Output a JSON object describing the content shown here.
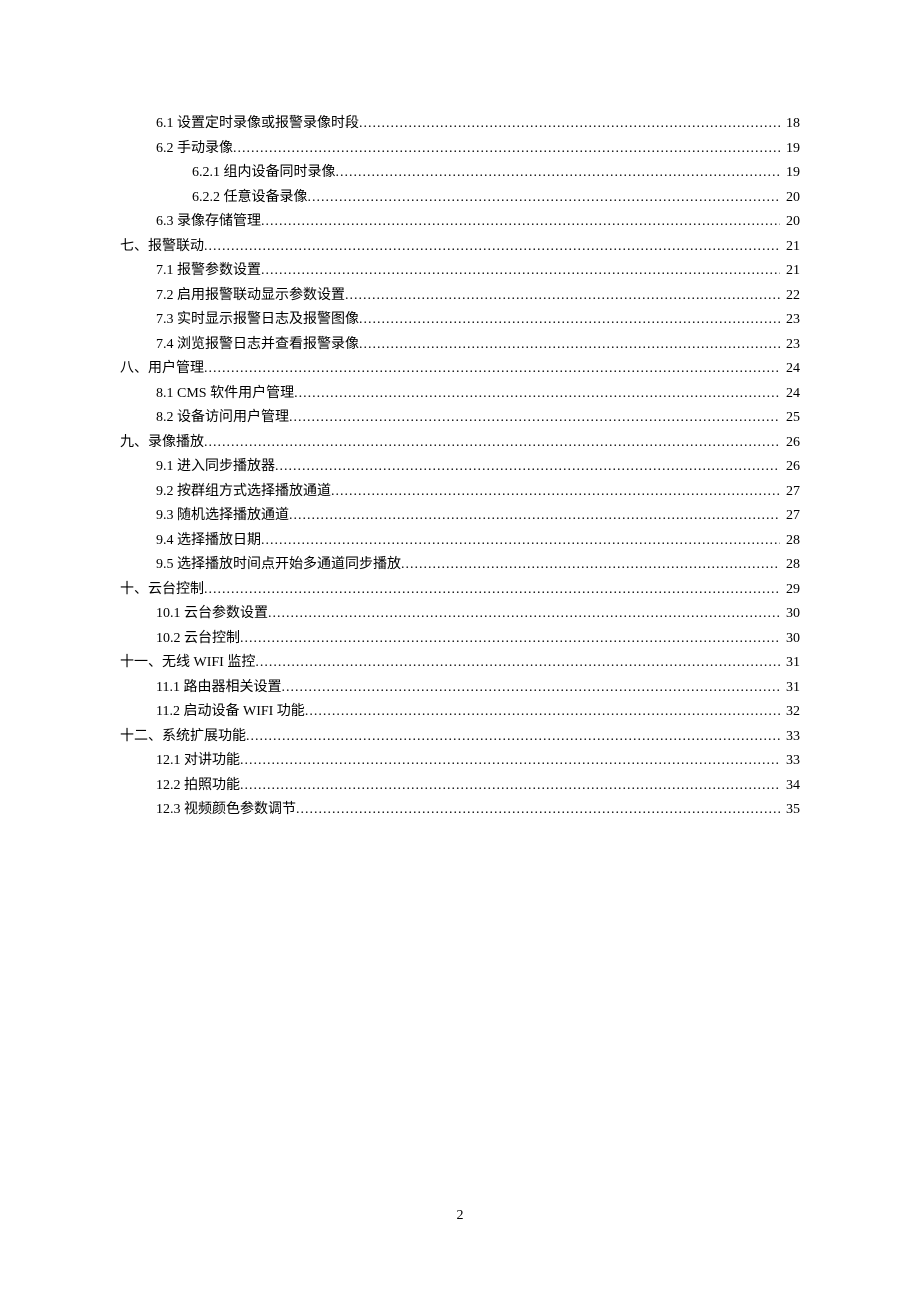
{
  "page_number": "2",
  "toc": [
    {
      "level": 1,
      "title": "6.1 设置定时录像或报警录像时段",
      "page": "18"
    },
    {
      "level": 1,
      "title": "6.2 手动录像",
      "page": "19"
    },
    {
      "level": 2,
      "title": "6.2.1 组内设备同时录像",
      "page": "19"
    },
    {
      "level": 2,
      "title": "6.2.2 任意设备录像",
      "page": "20"
    },
    {
      "level": 1,
      "title": "6.3 录像存储管理",
      "page": "20"
    },
    {
      "level": 0,
      "title": "七、报警联动",
      "page": "21"
    },
    {
      "level": 1,
      "title": "7.1 报警参数设置",
      "page": "21"
    },
    {
      "level": 1,
      "title": "7.2 启用报警联动显示参数设置",
      "page": "22"
    },
    {
      "level": 1,
      "title": "7.3 实时显示报警日志及报警图像",
      "page": "23"
    },
    {
      "level": 1,
      "title": "7.4 浏览报警日志并查看报警录像",
      "page": "23"
    },
    {
      "level": 0,
      "title": "八、用户管理",
      "page": "24"
    },
    {
      "level": 1,
      "title": "8.1 CMS 软件用户管理",
      "page": "24"
    },
    {
      "level": 1,
      "title": "8.2 设备访问用户管理",
      "page": "25"
    },
    {
      "level": 0,
      "title": "九、录像播放",
      "page": "26"
    },
    {
      "level": 1,
      "title": "9.1 进入同步播放器",
      "page": "26"
    },
    {
      "level": 1,
      "title": "9.2 按群组方式选择播放通道",
      "page": "27"
    },
    {
      "level": 1,
      "title": "9.3 随机选择播放通道",
      "page": "27"
    },
    {
      "level": 1,
      "title": "9.4 选择播放日期",
      "page": "28"
    },
    {
      "level": 1,
      "title": "9.5 选择播放时间点开始多通道同步播放",
      "page": "28"
    },
    {
      "level": 0,
      "title": "十、云台控制",
      "page": "29"
    },
    {
      "level": 1,
      "title": "10.1 云台参数设置",
      "page": "30"
    },
    {
      "level": 1,
      "title": "10.2 云台控制",
      "page": "30"
    },
    {
      "level": 0,
      "title": "十一、无线 WIFI 监控",
      "page": "31"
    },
    {
      "level": 1,
      "title": "11.1 路由器相关设置",
      "page": "31"
    },
    {
      "level": 1,
      "title": "11.2 启动设备 WIFI 功能",
      "page": "32"
    },
    {
      "level": 0,
      "title": "十二、系统扩展功能",
      "page": "33"
    },
    {
      "level": 1,
      "title": "12.1 对讲功能",
      "page": "33"
    },
    {
      "level": 1,
      "title": "12.2 拍照功能",
      "page": "34"
    },
    {
      "level": 1,
      "title": "12.3 视频颜色参数调节",
      "page": "35"
    }
  ]
}
